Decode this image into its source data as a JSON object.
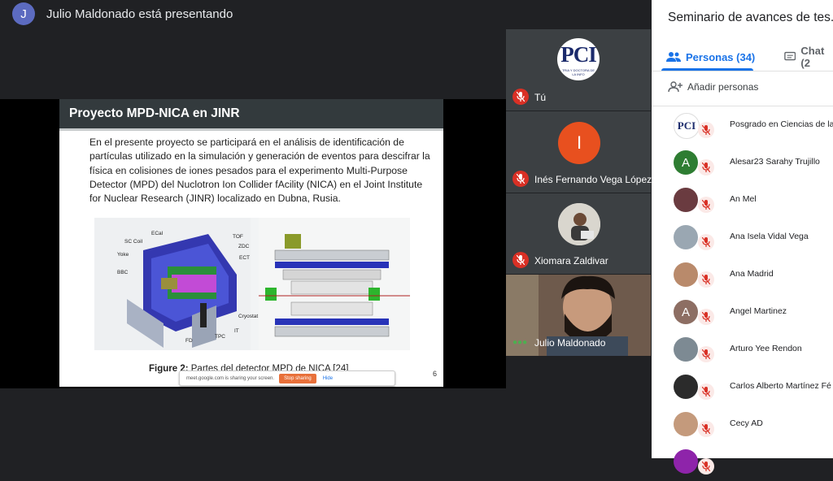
{
  "presenter_bar": {
    "initial": "J",
    "text": "Julio Maldonado está presentando"
  },
  "slide": {
    "title": "Proyecto MPD-NICA en JINR",
    "body": "En el presente proyecto se participará en el análisis de identificación de partículas utilizado en la simulación y generación de eventos para descifrar la física en colisiones de iones pesados para el experimento Multi-Purpose Detector (MPD) del Nuclotron Ion Collider fAcility (NICA) en el Joint Institute for Nuclear Research (JINR) localizado en Dubna, Rusia.",
    "figure_labels": {
      "ecal": "ECal",
      "sc_coil": "SC Coil",
      "yoke": "Yoke",
      "bbc": "BBC",
      "fd": "FD",
      "tpc": "TPC",
      "it": "IT",
      "cryostat": "Cryostat",
      "tof": "TOF",
      "zdc": "ZDC",
      "ect": "ECT"
    },
    "caption_label": "Figure 2:",
    "caption_text": "Partes del detector MPD de NICA",
    "caption_ref": "[24]",
    "page_number": "6"
  },
  "share_bar": {
    "text": "meet.google.com is sharing your screen.",
    "stop_label": "Stop sharing",
    "hide_label": "Hide"
  },
  "tiles": [
    {
      "name": "Tú",
      "logo_text": "PCI",
      "logo_subtext": "TRIA Y DOCTORA DE LA INFO"
    },
    {
      "name": "Inés Fernando Vega López",
      "initial": "I"
    },
    {
      "name": "Xiomara Zaldivar"
    },
    {
      "name": "Julio Maldonado"
    }
  ],
  "panel": {
    "title": "Seminario de avances de tes...",
    "tab_people": "Personas (34)",
    "tab_chat": "Chat (2",
    "add_people": "Añadir personas",
    "people": [
      {
        "name": "Posgrado en Ciencias de la Inf",
        "initial": "PCI",
        "color": "#ffffff"
      },
      {
        "name": "Alesar23 Sarahy Trujillo",
        "initial": "A",
        "color": "#2e7d32"
      },
      {
        "name": "An Mel",
        "initial": "",
        "color": "#6a3b40"
      },
      {
        "name": "Ana Isela Vidal Vega",
        "initial": "",
        "color": "#9aa7b2"
      },
      {
        "name": "Ana Madrid",
        "initial": "",
        "color": "#b98a6b"
      },
      {
        "name": "Angel Martinez",
        "initial": "A",
        "color": "#8d6e63"
      },
      {
        "name": "Arturo Yee Rendon",
        "initial": "",
        "color": "#7d8a93"
      },
      {
        "name": "Carlos Alberto Martínez Fé",
        "initial": "",
        "color": "#2b2b2b"
      },
      {
        "name": "Cecy AD",
        "initial": "",
        "color": "#c49a7c"
      },
      {
        "name": "",
        "initial": "",
        "color": "#8e24aa"
      }
    ]
  }
}
